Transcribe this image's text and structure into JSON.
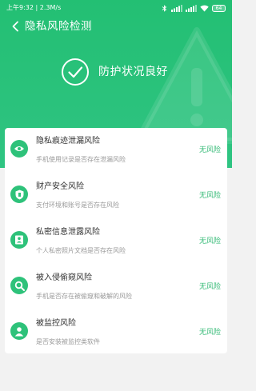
{
  "status_bar": {
    "text": "上午9:32 | 2.3M/s",
    "battery": "64",
    "icons": [
      "alarm-icon",
      "notification-icon",
      "bluetooth-icon",
      "signal-icon",
      "signal-icon",
      "wifi-icon",
      "battery-icon"
    ]
  },
  "header": {
    "title": "隐私风险检测",
    "back_icon": "chevron-left-icon"
  },
  "hero": {
    "status_text": "防护状况良好",
    "icon": "check-circle-icon"
  },
  "risks": [
    {
      "title": "隐私痕迹泄漏风险",
      "desc": "手机使用记录是否存在泄漏风险",
      "status": "无风险",
      "icon": "eye-icon"
    },
    {
      "title": "财产安全风险",
      "desc": "支付环境和账号是否存在风险",
      "status": "无风险",
      "icon": "shield-icon"
    },
    {
      "title": "私密信息泄露风险",
      "desc": "个人私密照片文档是否存在风险",
      "status": "无风险",
      "icon": "id-card-icon"
    },
    {
      "title": "被入侵偷窥风险",
      "desc": "手机是否存在被偷窥和破解的风险",
      "status": "无风险",
      "icon": "search-icon"
    },
    {
      "title": "被监控风险",
      "desc": "是否安装被监控类软件",
      "status": "无风险",
      "icon": "person-icon"
    }
  ],
  "colors": {
    "accent": "#2ec27a",
    "status_text": "#2fb872",
    "background": "#f2f2f2"
  }
}
